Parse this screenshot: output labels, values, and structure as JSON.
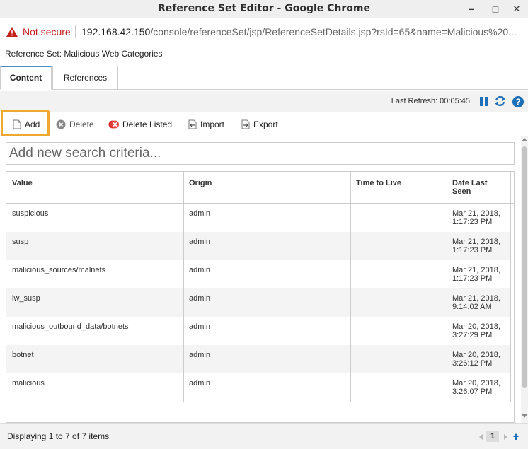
{
  "window": {
    "title": "Reference Set Editor - Google Chrome",
    "minimize": "–",
    "maximize": "□",
    "close": "✕"
  },
  "address": {
    "security_label": "Not secure",
    "host": "192.168.42.150",
    "path": "/console/referenceSet/jsp/ReferenceSetDetails.jsp?rsId=65&name=Malicious%20..."
  },
  "header": {
    "title": "Reference Set: Malicious Web Categories"
  },
  "tabs": [
    {
      "label": "Content",
      "active": true
    },
    {
      "label": "References",
      "active": false
    }
  ],
  "refresh": {
    "label": "Last Refresh: 00:05:45",
    "help": "?"
  },
  "toolbar": {
    "add": "Add",
    "delete": "Delete",
    "delete_listed": "Delete Listed",
    "import": "Import",
    "export": "Export"
  },
  "search": {
    "placeholder": "Add new search criteria..."
  },
  "grid": {
    "columns": [
      "Value",
      "Origin",
      "Time to Live",
      "Date Last Seen"
    ],
    "rows": [
      {
        "value": "suspicious",
        "origin": "admin",
        "ttl": "",
        "date1": "Mar 21, 2018,",
        "date2": "1:17:23 PM"
      },
      {
        "value": "susp",
        "origin": "admin",
        "ttl": "",
        "date1": "Mar 21, 2018,",
        "date2": "1:17:23 PM"
      },
      {
        "value": "malicious_sources/malnets",
        "origin": "admin",
        "ttl": "",
        "date1": "Mar 21, 2018,",
        "date2": "1:17:23 PM"
      },
      {
        "value": "iw_susp",
        "origin": "admin",
        "ttl": "",
        "date1": "Mar 21, 2018,",
        "date2": "9:14:02 AM"
      },
      {
        "value": "malicious_outbound_data/botnets",
        "origin": "admin",
        "ttl": "",
        "date1": "Mar 20, 2018,",
        "date2": "3:27:29 PM"
      },
      {
        "value": "botnet",
        "origin": "admin",
        "ttl": "",
        "date1": "Mar 20, 2018,",
        "date2": "3:26:12 PM"
      },
      {
        "value": "malicious",
        "origin": "admin",
        "ttl": "",
        "date1": "Mar 20, 2018,",
        "date2": "3:26:07 PM"
      }
    ]
  },
  "footer": {
    "status": "Displaying 1 to 7 of 7 items",
    "page": "1"
  },
  "colors": {
    "accent_blue": "#1d6fb8",
    "highlight_orange": "#f0a830",
    "warning_red": "#c5221f",
    "delete_listed_red": "#d9302c"
  }
}
